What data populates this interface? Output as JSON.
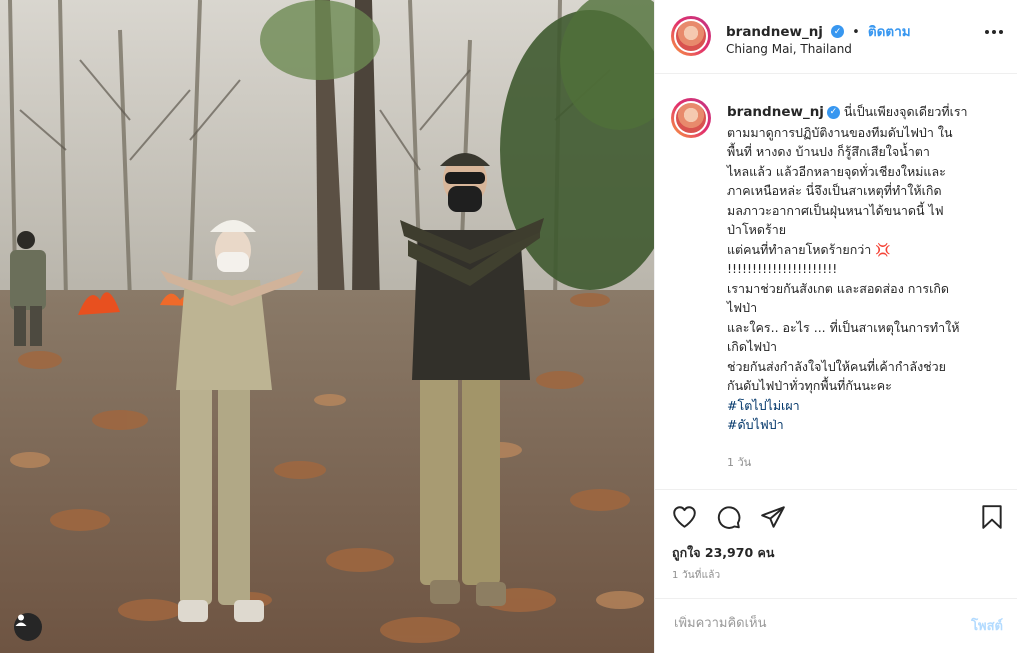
{
  "post": {
    "username": "brandnew_nj",
    "follow_label": "ติดตาม",
    "separator": "•",
    "location": "Chiang Mai, Thailand"
  },
  "caption": {
    "username": "brandnew_nj",
    "text": "นี่เป็นเพียงจุดเดียวที่เรา\nตามมาดูการปฏิบัติงานของทีมดับไฟป่า ใน\nพื้นที่ หางดง บ้านปง ก็รู้สึกเสียใจน้ำตา\nไหลแล้ว แล้วอีกหลายจุดทั่วเชียงใหม่และ\nภาคเหนือหล่ะ นี่จึงเป็นสาเหตุที่ทำให้เกิด\nมลภาวะอากาศเป็นฝุ่นหนาได้ขนาดนี้ ไฟ\nป่าโหดร้าย\nแต่คนที่ทำลายโหดร้ายกว่า 💢\n!!!!!!!!!!!!!!!!!!!!!!\nเรามาช่วยกันสังเกต และสอดส่อง การเกิด\nไฟป่า\nและใคร.. อะไร ... ที่เป็นสาเหตุในการทำให้\nเกิดไฟป่า\nช่วยกันส่งกำลังใจไปให้คนที่เค้ากำลังช่วย\nกันดับไฟป่าทั่วทุกพื้นที่กันนะคะ",
    "hashtags": [
      "#โตไปไม่เผา",
      "#ดับไฟป่า"
    ],
    "age": "1 วัน"
  },
  "actions": {
    "likes": "ถูกใจ 23,970 คน",
    "posted": "1 วันที่แล้ว"
  },
  "comment": {
    "placeholder": "เพิ่มความคิดเห็น",
    "post_label": "โพสต์"
  },
  "icons": {
    "like": "heart-icon",
    "comment": "comment-icon",
    "share": "share-icon",
    "save": "bookmark-icon",
    "tag": "user-tag-icon",
    "more": "more-options-icon"
  },
  "colors": {
    "link": "#3897f0",
    "hashtag": "#003569",
    "muted": "#8e8e8e",
    "post_disabled": "#b3dbff"
  }
}
